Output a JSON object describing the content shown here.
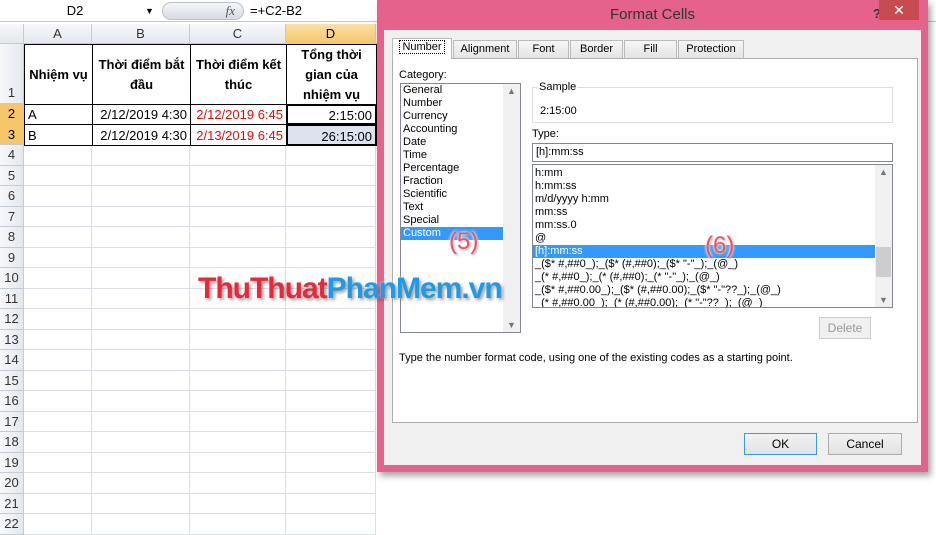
{
  "formula_bar": {
    "name_box": "D2",
    "fx": "fx",
    "formula": "=+C2-B2"
  },
  "sheet": {
    "columns": [
      "A",
      "B",
      "C",
      "D"
    ],
    "rows": [
      "1",
      "2",
      "3",
      "4",
      "5",
      "6",
      "7",
      "8",
      "9",
      "10",
      "11",
      "12",
      "13",
      "14",
      "15",
      "16",
      "17",
      "18",
      "19",
      "20",
      "21",
      "22"
    ],
    "header": [
      "Nhiệm vụ",
      "Thời điểm bắt đầu",
      "Thời điểm kết thúc",
      "Tổng thời gian của nhiệm vụ"
    ],
    "data": [
      [
        "A",
        "2/12/2019 4:30",
        "2/12/2019 6:45",
        "2:15:00"
      ],
      [
        "B",
        "2/12/2019 4:30",
        "2/13/2019 6:45",
        "26:15:00"
      ]
    ]
  },
  "dialog": {
    "title": "Format Cells",
    "help": "?",
    "close": "✕",
    "tabs": [
      "Number",
      "Alignment",
      "Font",
      "Border",
      "Fill",
      "Protection"
    ],
    "category_label": "Category:",
    "categories": [
      "General",
      "Number",
      "Currency",
      "Accounting",
      "Date",
      "Time",
      "Percentage",
      "Fraction",
      "Scientific",
      "Text",
      "Special",
      "Custom"
    ],
    "selected_category": "Custom",
    "sample_label": "Sample",
    "sample_value": "2:15:00",
    "type_label": "Type:",
    "type_value": "[h]:mm:ss",
    "type_list": [
      "h:mm",
      "h:mm:ss",
      "m/d/yyyy h:mm",
      "mm:ss",
      "mm:ss.0",
      "@",
      "[h]:mm:ss",
      "_($* #,##0_);_($* (#,##0);_($* \"-\"_);_(@_)",
      "_(* #,##0_);_(* (#,##0);_(* \"-\"_);_(@_)",
      "_($* #,##0.00_);_($* (#,##0.00);_($* \"-\"??_);_(@_)",
      "_(* #,##0.00_);_(* (#,##0.00);_(* \"-\"??_);_(@_)"
    ],
    "selected_type": "[h]:mm:ss",
    "delete": "Delete",
    "description": "Type the number format code, using one of the existing codes as a starting point.",
    "ok": "OK",
    "cancel": "Cancel"
  },
  "annotations": {
    "step5": "(5)",
    "step6": "(6)"
  },
  "watermark": {
    "part1": "ThuThuat",
    "part2": "PhanMem.vn"
  },
  "colors": {
    "accent": "#3399ff",
    "dialog_border": "#e5628c",
    "red_text": "#ff0000",
    "watermark_red": "#e8283c",
    "watermark_blue": "#1e9be6"
  }
}
